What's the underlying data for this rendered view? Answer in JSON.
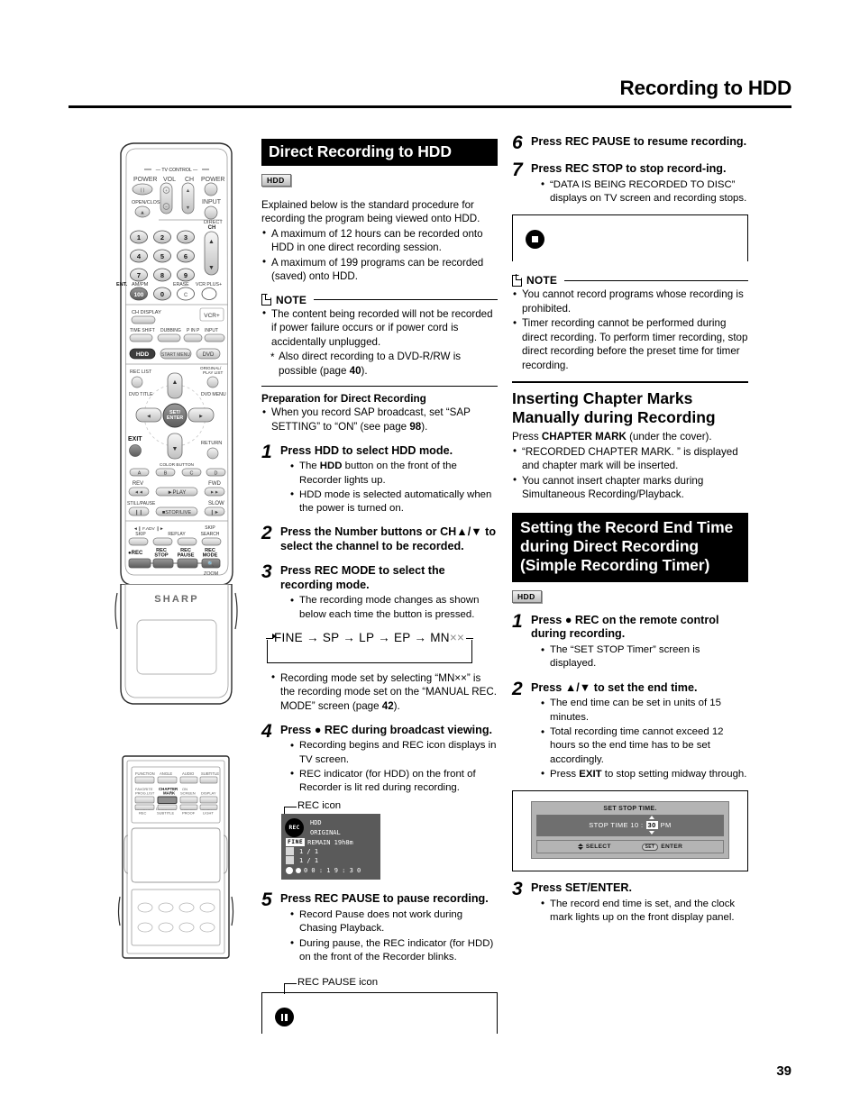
{
  "page": {
    "header_title": "Recording to HDD",
    "page_number": "39"
  },
  "mid_column": {
    "banner": "Direct Recording to HDD",
    "media_badge": "HDD",
    "intro": "Explained below is the standard procedure for recording the program being viewed onto HDD.",
    "intro_bullets": [
      "A maximum of 12 hours can be recorded onto HDD in one direct recording session.",
      "A maximum of 199 programs can be recorded (saved) onto HDD."
    ],
    "note_label": "NOTE",
    "note_bullets": [
      "The content being recorded will not be recorded if power failure occurs or if power cord is accidentally unplugged."
    ],
    "note_star": "Also direct recording to a DVD-R/RW is possible (page 40).",
    "note_star_page": "40",
    "prep_heading": "Preparation for Direct Recording",
    "prep_bullet_pre": "When you record SAP broadcast, set “SAP SETTING” to “ON” (see page ",
    "prep_bullet_page": "98",
    "prep_bullet_post": ").",
    "steps": [
      {
        "num": "1",
        "title_parts": [
          {
            "t": "Press ",
            "b": false
          },
          {
            "t": "HDD",
            "b": true
          },
          {
            "t": " to select HDD mode.",
            "b": false
          }
        ],
        "bullets_rich": [
          [
            {
              "t": "The ",
              "b": false
            },
            {
              "t": "HDD",
              "b": true
            },
            {
              "t": " button on the front of the Recorder lights up.",
              "b": false
            }
          ],
          [
            {
              "t": "HDD mode is selected automatically when the power is turned on.",
              "b": false
            }
          ]
        ]
      },
      {
        "num": "2",
        "title_parts": [
          {
            "t": "Press the ",
            "b": false
          },
          {
            "t": "Number",
            "b": true
          },
          {
            "t": " buttons or ",
            "b": false
          },
          {
            "t": "CH▲/▼",
            "b": true
          },
          {
            "t": " to select the channel to be recorded.",
            "b": false
          }
        ],
        "bullets_rich": []
      },
      {
        "num": "3",
        "title_parts": [
          {
            "t": "Press ",
            "b": false
          },
          {
            "t": "REC MODE",
            "b": true
          },
          {
            "t": " to select the recording mode.",
            "b": false
          }
        ],
        "bullets_rich": [
          [
            {
              "t": "The recording mode changes as shown below each time the button is pressed.",
              "b": false
            }
          ]
        ]
      },
      {
        "num": "4",
        "title_parts": [
          {
            "t": "Press ",
            "b": false
          },
          {
            "t": "● REC",
            "b": true
          },
          {
            "t": " during broadcast viewing.",
            "b": false
          }
        ],
        "bullets_rich": [
          [
            {
              "t": "Recording begins and REC icon displays in TV screen.",
              "b": false
            }
          ],
          [
            {
              "t": "REC indicator (for HDD) on the front of Recorder is lit red during recording.",
              "b": false
            }
          ]
        ]
      },
      {
        "num": "5",
        "title_parts": [
          {
            "t": "Press ",
            "b": false
          },
          {
            "t": "REC PAUSE",
            "b": true
          },
          {
            "t": " to pause recording.",
            "b": false
          }
        ],
        "bullets_rich": [
          [
            {
              "t": "Record Pause does not work during Chasing Playback.",
              "b": false
            }
          ],
          [
            {
              "t": "During pause, the REC indicator (for HDD) on the front of the Recorder blinks.",
              "b": false
            }
          ]
        ]
      }
    ],
    "recmode_flow": {
      "items": [
        "FINE",
        "SP",
        "LP",
        "EP",
        "MN"
      ],
      "suffix": "××",
      "arrow": "→"
    },
    "recmode_note_parts": [
      {
        "t": "Recording mode set by selecting “MN××” is the recording mode set on the “MANUAL REC. MODE” screen (page ",
        "b": false
      },
      {
        "t": "42",
        "b": true
      },
      {
        "t": ").",
        "b": false
      }
    ],
    "rec_icon_caption": "REC icon",
    "rec_pause_caption": "REC PAUSE icon",
    "osd": {
      "rec_badge": "REC",
      "line1": "HDD",
      "line2": "ORIGINAL",
      "mode_chip": "FINE",
      "remain": "REMAIN 19h8m",
      "counter1": "1 / 1",
      "counter2": "1 / 1",
      "time": "0 0 : 1 9 : 3 0"
    }
  },
  "right_column": {
    "steps_top": [
      {
        "num": "6",
        "title_parts": [
          {
            "t": "Press ",
            "b": false
          },
          {
            "t": "REC PAUSE",
            "b": true
          },
          {
            "t": " to resume recording.",
            "b": false
          }
        ],
        "bullets_rich": []
      },
      {
        "num": "7",
        "title_parts": [
          {
            "t": "Press ",
            "b": false
          },
          {
            "t": "REC STOP",
            "b": true
          },
          {
            "t": " to stop record-ing.",
            "b": false
          }
        ],
        "bullets_rich": [
          [
            {
              "t": "“DATA IS BEING RECORDED TO DISC” displays on TV screen and recording stops.",
              "b": false
            }
          ]
        ]
      }
    ],
    "note_label": "NOTE",
    "note_bullets": [
      "You cannot record programs whose recording is prohibited.",
      "Timer recording cannot be performed during direct recording.  To perform timer recording, stop direct recording before the preset time for timer recording."
    ],
    "chapter_heading": "Inserting Chapter Marks Manually during Recording",
    "chapter_lead_parts": [
      {
        "t": "Press ",
        "b": false
      },
      {
        "t": "CHAPTER MARK",
        "b": true
      },
      {
        "t": " (under the cover).",
        "b": false
      }
    ],
    "chapter_bullets": [
      "“RECORDED CHAPTER MARK. ” is displayed and chapter mark will be inserted.",
      "You cannot insert chapter marks during Simultaneous Recording/Playback."
    ],
    "banner2": "Setting the Record End Time during Direct Recording (Simple Recording Timer)",
    "media_badge2": "HDD",
    "steps_bottom": [
      {
        "num": "1",
        "title_parts": [
          {
            "t": "Press ",
            "b": false
          },
          {
            "t": "● REC",
            "b": true
          },
          {
            "t": " on the remote control during recording.",
            "b": false
          }
        ],
        "bullets_rich": [
          [
            {
              "t": "The “SET STOP Timer” screen is displayed.",
              "b": false
            }
          ]
        ]
      },
      {
        "num": "2",
        "title_parts": [
          {
            "t": "Press ",
            "b": false
          },
          {
            "t": "▲/▼",
            "b": true
          },
          {
            "t": " to set the end time.",
            "b": false
          }
        ],
        "bullets_rich": [
          [
            {
              "t": "The end time can be set in units of 15 minutes.",
              "b": false
            }
          ],
          [
            {
              "t": "Total recording time cannot exceed 12 hours so the end time has to be set accordingly.",
              "b": false
            }
          ],
          [
            {
              "t": "Press ",
              "b": false
            },
            {
              "t": "EXIT",
              "b": true
            },
            {
              "t": " to stop setting midway through.",
              "b": false
            }
          ]
        ]
      },
      {
        "num": "3",
        "title_parts": [
          {
            "t": "Press ",
            "b": false
          },
          {
            "t": "SET/ENTER.",
            "b": true
          }
        ],
        "bullets_rich": [
          [
            {
              "t": "The record end time is set, and the clock mark lights up on the front display panel.",
              "b": false
            }
          ]
        ]
      }
    ],
    "stop_time_screen": {
      "title": "SET STOP TIME.",
      "label": "STOP TIME 10 :",
      "value": "30",
      "ampm": "PM",
      "foot_select": "SELECT",
      "foot_enter": "ENTER",
      "foot_enter_chip": "SET"
    }
  },
  "remote_top": {
    "section_tv_control": "TV CONTROL",
    "labels": {
      "power": "POWER",
      "vol": "VOL",
      "ch": "CH",
      "tv_power": "POWER",
      "open_close": "OPEN/CLOSE",
      "input": "INPUT",
      "ch_right": "CH",
      "direct": "DIRECT",
      "ent": "ENT.",
      "ampm": "AM/PM",
      "erase": "ERASE",
      "vcr_plus": "VCR PLUS+",
      "brand": "SHARP",
      "vcrplus_logo": "VCR+"
    },
    "numbers": [
      "1",
      "2",
      "3",
      "4",
      "5",
      "6",
      "7",
      "8",
      "9",
      "100",
      "0"
    ],
    "row_labels": {
      "ch_display": "CH DISPLAY",
      "time_shift": "TIME SHIFT",
      "dubbing": "DUBBING",
      "p_in_p": "P IN P",
      "input": "INPUT",
      "hdd": "HDD",
      "start_menu": "START MENU",
      "dvd": "DVD",
      "rec_list": "REC LIST",
      "original_playlist": "ORIGINAL/ PLAY LIST",
      "dvd_title": "DVD TITLE",
      "dvd_menu": "DVD MENU",
      "set_enter": "SET/ ENTER",
      "exit": "EXIT",
      "return": "RETURN",
      "color_button": "COLOR BUTTON",
      "color_a": "A",
      "color_b": "B",
      "color_c": "C",
      "color_d": "D",
      "rev": "REV",
      "fwd": "FWD",
      "play": "PLAY",
      "still_pause": "STILL/PAUSE",
      "slow": "SLOW",
      "stop_live": "STOP/LIVE",
      "f_adv": "F.ADV",
      "skip": "SKIP",
      "replay": "REPLAY",
      "skip_search": "SKIP SEARCH",
      "rec": "REC",
      "rec_stop": "REC STOP",
      "rec_pause": "REC PAUSE",
      "rec_mode": "REC MODE",
      "zoom": "ZOOM"
    }
  },
  "remote_bottom": {
    "labels": {
      "function": "FUNCTION",
      "angle": "ANGLE",
      "audio": "AUDIO",
      "subtitle": "SUBTITLE",
      "favorite_proglist": "FAVORITE PROG.LIST",
      "chapter_mark": "CHAPTER MARK",
      "on_screen": "ON SCREEN",
      "display": "DISPLAY",
      "av_auto_rec": "AV AUTO REC",
      "direction_subtitle": "DIRECTION SUBTITLE",
      "tamper_proof": "TAMPER PROOF",
      "back_light": "BACK LIGHT"
    }
  }
}
